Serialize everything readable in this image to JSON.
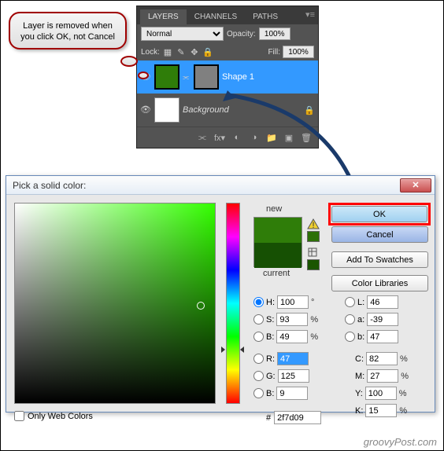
{
  "layersPanel": {
    "tabs": [
      "LAYERS",
      "CHANNELS",
      "PATHS"
    ],
    "blendMode": "Normal",
    "opacityLabel": "Opacity:",
    "opacityValue": "100%",
    "lockLabel": "Lock:",
    "fillLabel": "Fill:",
    "fillValue": "100%",
    "layers": [
      {
        "name": "Shape 1",
        "selected": true
      },
      {
        "name": "Background",
        "selected": false
      }
    ]
  },
  "callout": {
    "text": "Layer is removed when you click OK, not Cancel"
  },
  "dialog": {
    "title": "Pick a solid color:",
    "newLabel": "new",
    "currentLabel": "current",
    "ok": "OK",
    "cancel": "Cancel",
    "addSwatches": "Add To Swatches",
    "colorLibraries": "Color Libraries",
    "onlyWeb": "Only Web Colors",
    "fields": {
      "H": {
        "label": "H:",
        "value": "100",
        "unit": "°"
      },
      "S": {
        "label": "S:",
        "value": "93",
        "unit": "%"
      },
      "B": {
        "label": "B:",
        "value": "49",
        "unit": "%"
      },
      "R": {
        "label": "R:",
        "value": "47"
      },
      "G": {
        "label": "G:",
        "value": "125"
      },
      "Bb": {
        "label": "B:",
        "value": "9"
      },
      "L": {
        "label": "L:",
        "value": "46"
      },
      "a": {
        "label": "a:",
        "value": "-39"
      },
      "bb": {
        "label": "b:",
        "value": "47"
      },
      "C": {
        "label": "C:",
        "value": "82",
        "unit": "%"
      },
      "M": {
        "label": "M:",
        "value": "27",
        "unit": "%"
      },
      "Y": {
        "label": "Y:",
        "value": "100",
        "unit": "%"
      },
      "K": {
        "label": "K:",
        "value": "15",
        "unit": "%"
      },
      "hex": {
        "label": "#",
        "value": "2f7d09"
      }
    }
  },
  "watermark": "groovyPost.com"
}
